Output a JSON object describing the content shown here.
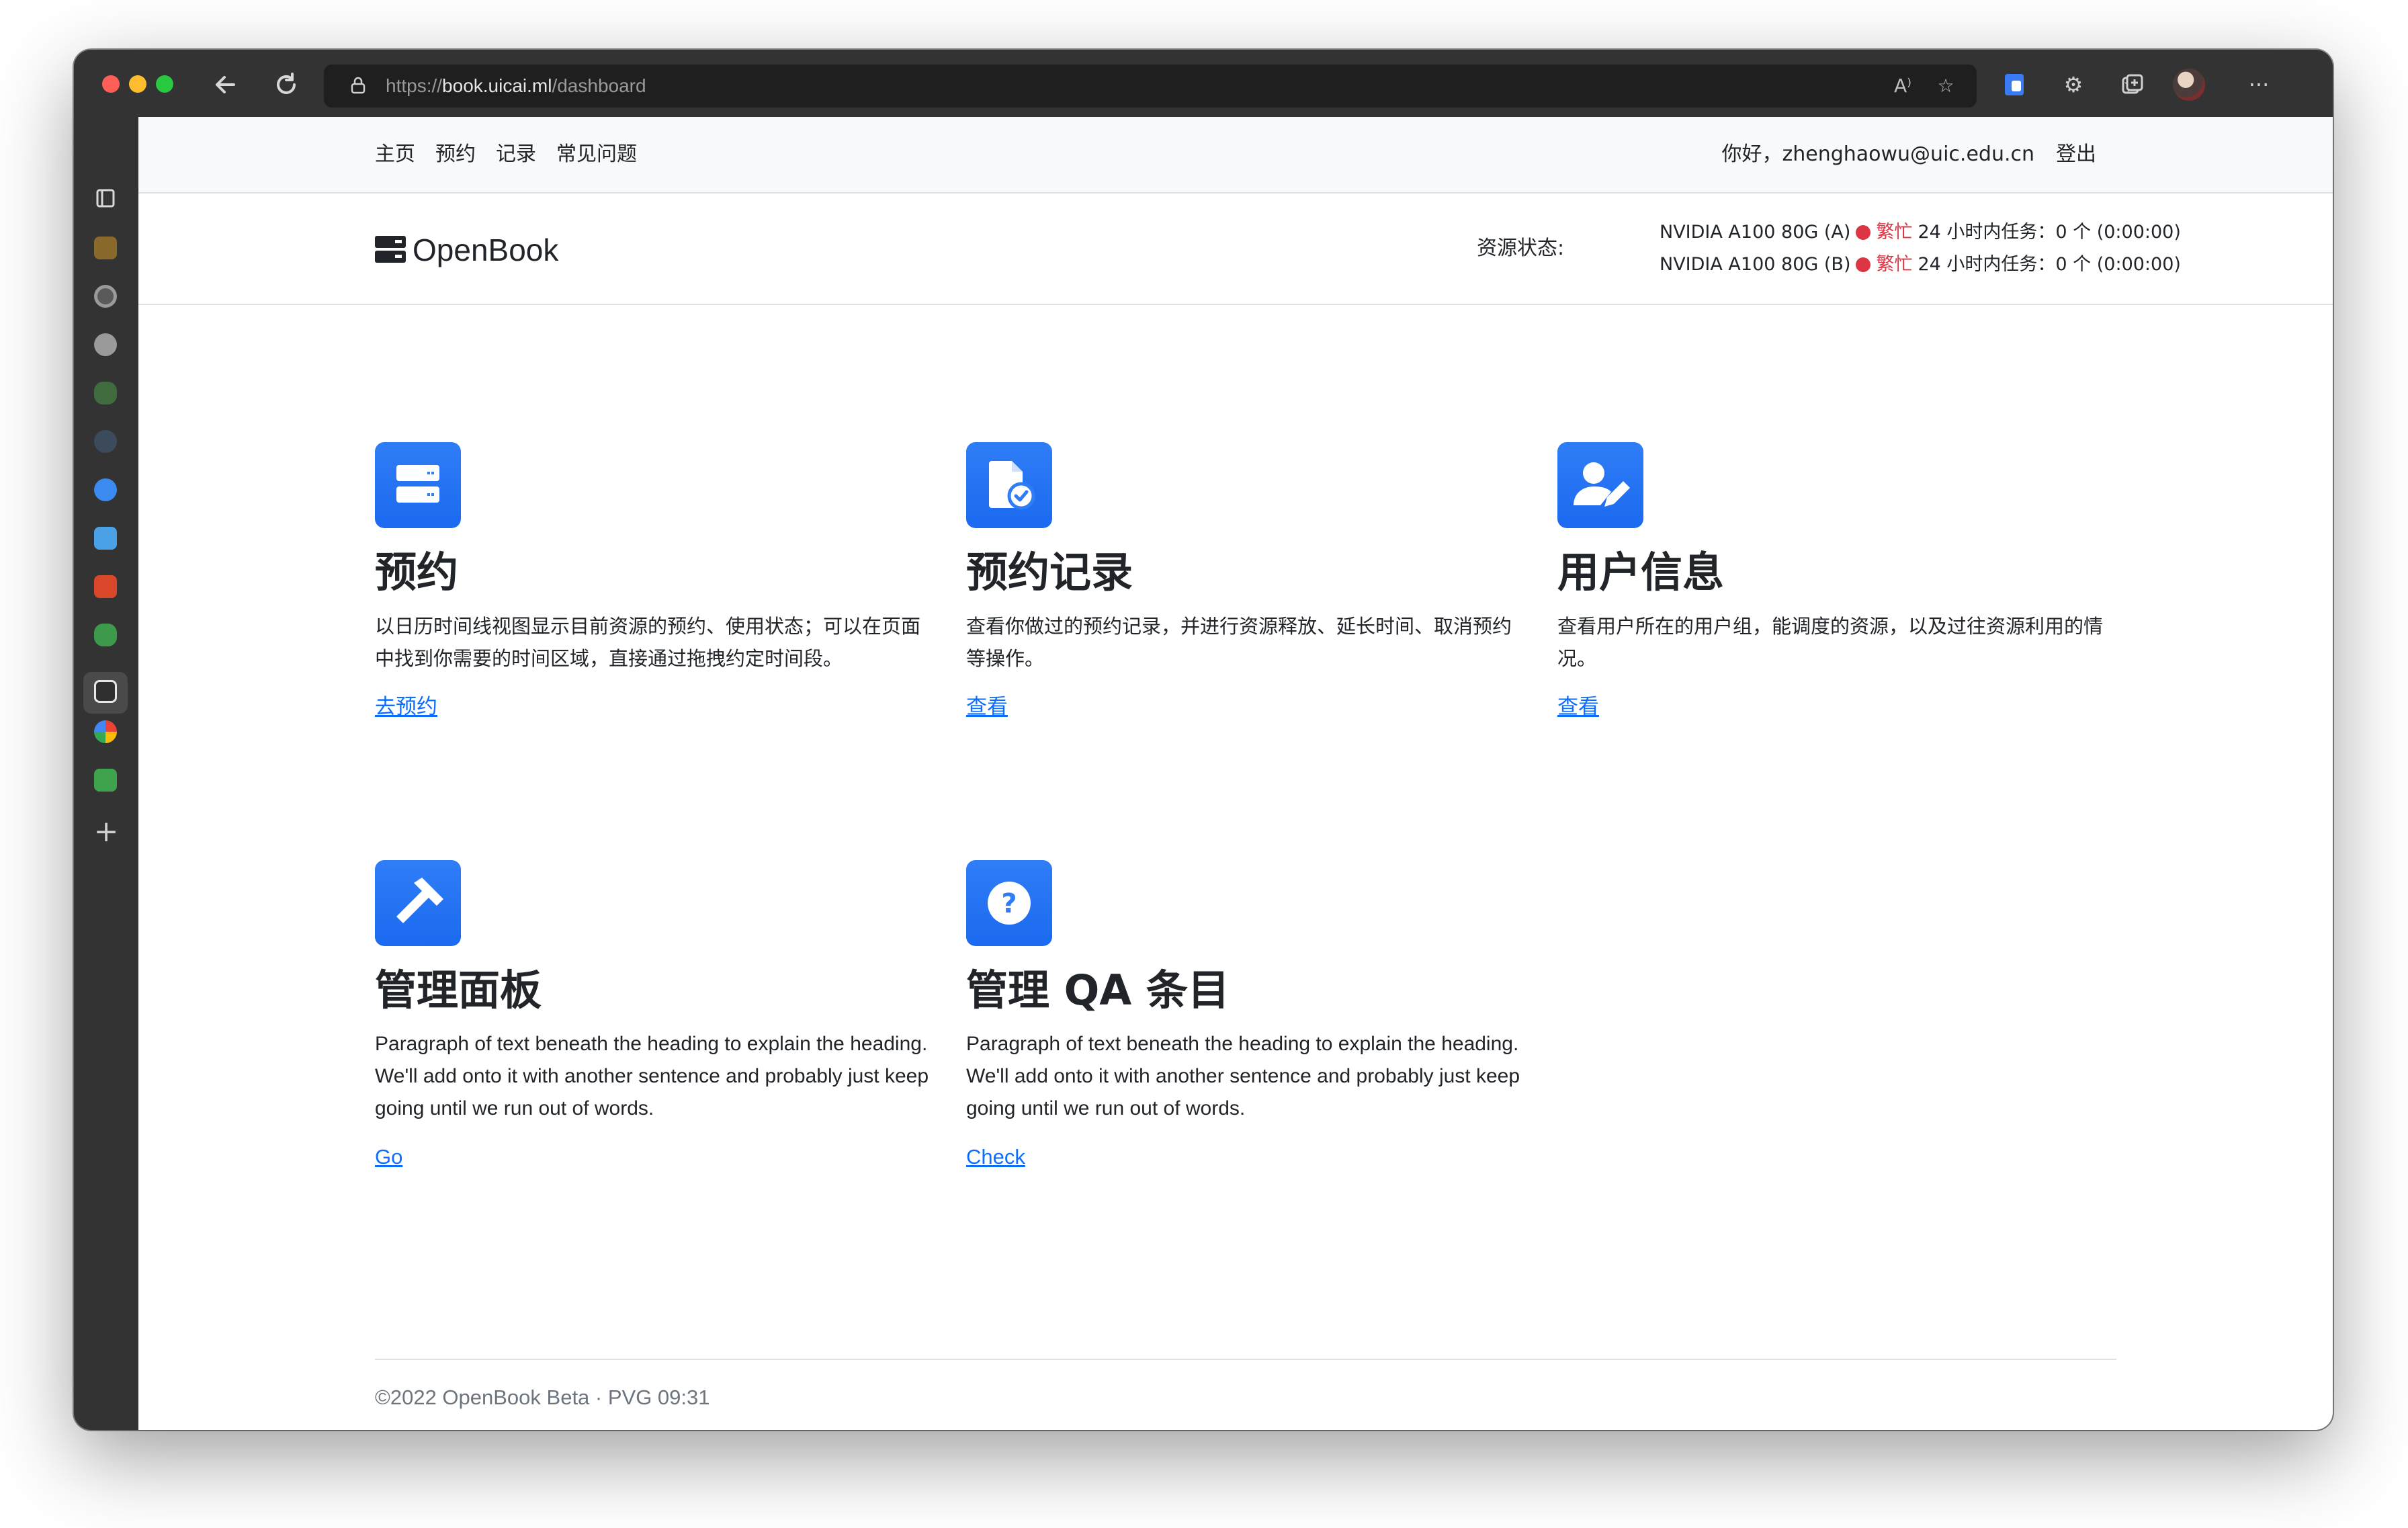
{
  "browser": {
    "url_prefix": "https://",
    "url_host": "book.uicai.ml",
    "url_path": "/dashboard"
  },
  "nav": {
    "links": [
      "主页",
      "预约",
      "记录",
      "常见问题"
    ],
    "greeting": "你好，zhenghaowu@uic.edu.cn",
    "logout": "登出"
  },
  "header": {
    "brand": "OpenBook",
    "status_label": "资源状态:",
    "resources": [
      {
        "name": "NVIDIA A100 80G (A)",
        "state": "繁忙",
        "tasks": "24 小时内任务：0 个 (0:00:00)",
        "state_color": "#dc3545"
      },
      {
        "name": "NVIDIA A100 80G (B)",
        "state": "繁忙",
        "tasks": "24 小时内任务：0 个 (0:00:00)",
        "state_color": "#dc3545"
      }
    ]
  },
  "features": [
    {
      "icon": "server-icon",
      "title": "预约",
      "desc": "以日历时间线视图显示目前资源的预约、使用状态；可以在页面中找到你需要的时间区域，直接通过拖拽约定时间段。",
      "link": "去预约"
    },
    {
      "icon": "document-check-icon",
      "title": "预约记录",
      "desc": "查看你做过的预约记录，并进行资源释放、延长时间、取消预约等操作。",
      "link": "查看"
    },
    {
      "icon": "user-edit-icon",
      "title": "用户信息",
      "desc": "查看用户所在的用户组，能调度的资源，以及过往资源利用的情况。",
      "link": "查看"
    },
    {
      "icon": "hammer-icon",
      "title": "管理面板",
      "desc": "Paragraph of text beneath the heading to explain the heading. We'll add onto it with another sentence and probably just keep going until we run out of words.",
      "link": "Go"
    },
    {
      "icon": "question-icon",
      "title": "管理 QA 条目",
      "desc": "Paragraph of text beneath the heading to explain the heading. We'll add onto it with another sentence and probably just keep going until we run out of words.",
      "link": "Check"
    }
  ],
  "footer": {
    "text": "©2022 OpenBook Beta · PVG 09:31"
  },
  "colors": {
    "accent": "#0d6efd",
    "busy": "#dc3545"
  }
}
